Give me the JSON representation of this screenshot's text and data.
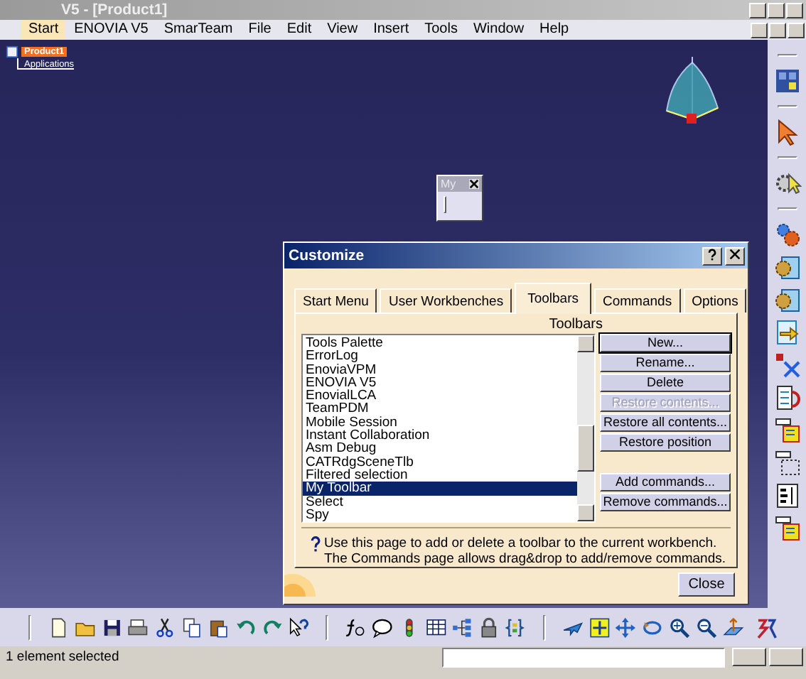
{
  "window": {
    "title": "V5 - [Product1]"
  },
  "menu": [
    {
      "label": "Start",
      "selected": true
    },
    {
      "label": "ENOVIA V5",
      "selected": false
    },
    {
      "label": "SmarTeam",
      "selected": false
    },
    {
      "label": "File",
      "selected": false
    },
    {
      "label": "Edit",
      "selected": false
    },
    {
      "label": "View",
      "selected": false
    },
    {
      "label": "Insert",
      "selected": false
    },
    {
      "label": "Tools",
      "selected": false
    },
    {
      "label": "Window",
      "selected": false
    },
    {
      "label": "Help",
      "selected": false
    }
  ],
  "tree": {
    "label": "Product1",
    "selected": true,
    "children": [
      {
        "label": "Applications"
      }
    ]
  },
  "floating_toolbar": {
    "title": "My"
  },
  "dialog": {
    "title": "Customize",
    "tabs": [
      {
        "label": "Start Menu",
        "selected": false
      },
      {
        "label": "User Workbenches",
        "selected": false
      },
      {
        "label": "Toolbars",
        "selected": true
      },
      {
        "label": "Commands",
        "selected": false
      },
      {
        "label": "Options",
        "selected": false
      }
    ],
    "list_label": "Toolbars",
    "toolbars": [
      {
        "label": "Tools Palette",
        "selected": false
      },
      {
        "label": "ErrorLog",
        "selected": false
      },
      {
        "label": "EnoviaVPM",
        "selected": false
      },
      {
        "label": "ENOVIA V5",
        "selected": false
      },
      {
        "label": "EnovialLCA",
        "selected": false
      },
      {
        "label": "TeamPDM",
        "selected": false
      },
      {
        "label": "Mobile Session",
        "selected": false
      },
      {
        "label": "Instant Collaboration",
        "selected": false
      },
      {
        "label": "Asm Debug",
        "selected": false
      },
      {
        "label": "CATRdgSceneTlb",
        "selected": false
      },
      {
        "label": "Filtered selection",
        "selected": false
      },
      {
        "label": "My Toolbar",
        "selected": true
      },
      {
        "label": "Select",
        "selected": false
      },
      {
        "label": "Spy",
        "selected": false
      }
    ],
    "buttons": [
      {
        "label": "New...",
        "disabled": false,
        "default": true
      },
      {
        "label": "Rename...",
        "disabled": false,
        "default": false
      },
      {
        "label": "Delete",
        "disabled": false,
        "default": false
      },
      {
        "label": "Restore contents...",
        "disabled": true,
        "default": false
      },
      {
        "label": "Restore all contents...",
        "disabled": false,
        "default": false
      },
      {
        "label": "Restore position",
        "disabled": false,
        "default": false
      },
      {
        "label": "Add commands...",
        "disabled": false,
        "default": false
      },
      {
        "label": "Remove commands...",
        "disabled": false,
        "default": false
      }
    ],
    "hint": [
      "Use this page to add or delete a toolbar to the current workbench.",
      "The Commands page allows drag&drop to add/remove commands."
    ],
    "close_button": "Close"
  },
  "status_bar": {
    "text": "1 element selected"
  }
}
